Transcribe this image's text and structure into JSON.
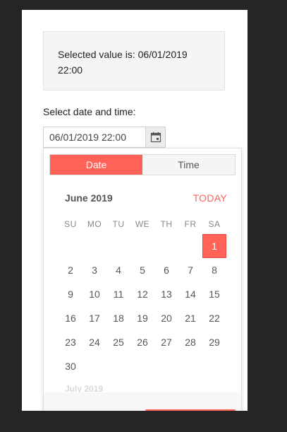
{
  "selected": {
    "text": "Selected value is: 06/01/2019 22:00"
  },
  "field": {
    "label": "Select date and time:",
    "value": "06/01/2019 22:00"
  },
  "popup": {
    "tabs": {
      "date": "Date",
      "time": "Time"
    },
    "active_tab": "Date",
    "month_title": "June 2019",
    "today_label": "TODAY",
    "next_month_title": "July 2019",
    "weekdays": [
      "SU",
      "MO",
      "TU",
      "WE",
      "TH",
      "FR",
      "SA"
    ],
    "weeks": [
      [
        "",
        "",
        "",
        "",
        "",
        "",
        "1"
      ],
      [
        "2",
        "3",
        "4",
        "5",
        "6",
        "7",
        "8"
      ],
      [
        "9",
        "10",
        "11",
        "12",
        "13",
        "14",
        "15"
      ],
      [
        "16",
        "17",
        "18",
        "19",
        "20",
        "21",
        "22"
      ],
      [
        "23",
        "24",
        "25",
        "26",
        "27",
        "28",
        "29"
      ],
      [
        "30",
        "",
        "",
        "",
        "",
        "",
        ""
      ]
    ],
    "selected_day": "1"
  },
  "colors": {
    "accent": "#ff6358",
    "background": "#252525"
  },
  "icons": {
    "calendar_button": "calendar-icon"
  }
}
